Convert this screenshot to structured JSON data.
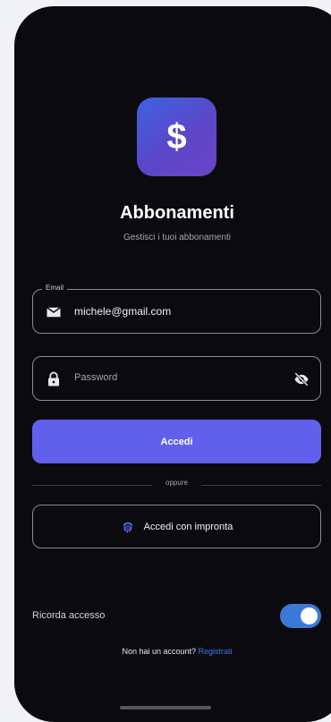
{
  "app": {
    "logo_symbol": "$",
    "title": "Abbonamenti",
    "subtitle": "Gestisci i tuoi abbonamenti"
  },
  "form": {
    "email": {
      "label": "Email",
      "value": "michele@gmail.com",
      "icon": "mail-icon"
    },
    "password": {
      "placeholder": "Password",
      "icon": "lock-icon",
      "visibility_icon": "eye-off-icon"
    },
    "login_label": "Accedi",
    "divider_text": "oppure",
    "fingerprint_label": "Accedi con impronta",
    "remember_label": "Ricorda accesso",
    "remember_on": true
  },
  "footer": {
    "prompt": "Non hai un account?",
    "link": "Registrati"
  },
  "colors": {
    "background": "#0b0b0f",
    "primary": "#6160ed",
    "toggle": "#3c78d8",
    "link": "#3f7ae0",
    "logo_gradient_start": "#3e62e0",
    "logo_gradient_end": "#6d44c8"
  }
}
